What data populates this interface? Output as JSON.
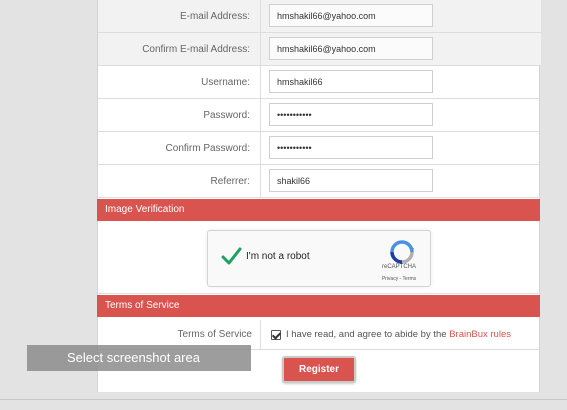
{
  "fields": [
    {
      "label": "E-mail Address:",
      "value": "hmshakil66@yahoo.com",
      "type": "text"
    },
    {
      "label": "Confirm E-mail Address:",
      "value": "hmshakil66@yahoo.com",
      "type": "text"
    },
    {
      "label": "Username:",
      "value": "hmshakil66",
      "type": "text"
    },
    {
      "label": "Password:",
      "value": "•••••••••••",
      "type": "password"
    },
    {
      "label": "Confirm Password:",
      "value": "•••••••••••",
      "type": "password"
    },
    {
      "label": "Referrer:",
      "value": "shakil66",
      "type": "text"
    }
  ],
  "image_verification": {
    "header": "Image Verification",
    "recaptcha": {
      "label": "I'm not a robot",
      "brand": "reCAPTCHA",
      "links": "Privacy - Terms",
      "checked": true
    }
  },
  "terms": {
    "header": "Terms of Service",
    "label": "Terms of Service",
    "agree_text": "I have read, and agree to abide by the ",
    "link_text": "BrainBux rules",
    "checked": true
  },
  "register": {
    "label": "Register"
  },
  "overlay": {
    "text": "Select screenshot area"
  },
  "colors": {
    "accent": "#d9534f",
    "background": "#e3e3e3"
  }
}
